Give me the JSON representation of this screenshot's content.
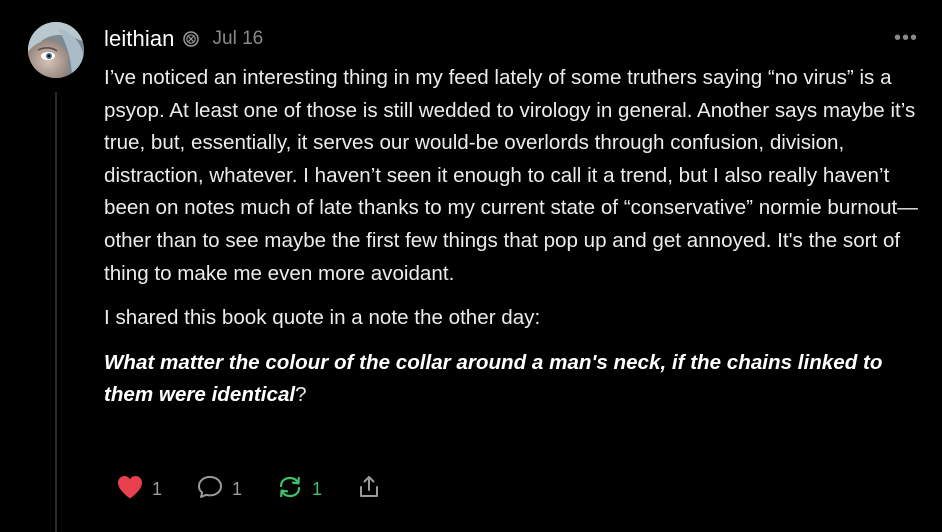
{
  "note": {
    "author": "leithian",
    "date": "Jul 16",
    "more_label": "•••",
    "paragraphs": [
      "I’ve noticed an interesting thing in my feed lately of some truthers saying “no virus” is a psyop. At least one of those is still wedded to virology in general. Another says maybe it’s true, but, essentially, it serves our would-be overlords through confusion, division, distraction, whatever. I haven’t seen it enough to call it a trend, but I also really haven’t been on notes much of late thanks to my current state of “conservative” normie burnout—other than to see maybe the first few things that pop up and get annoyed. It's the sort of thing to make me even more avoidant.",
      "I shared this book quote in a note the other day:"
    ],
    "quote": "What matter the colour of the collar around a man's neck, if the chains linked to them were identical",
    "quote_end": "?"
  },
  "actions": {
    "like_count": "1",
    "comment_count": "1",
    "restack_count": "1"
  },
  "icons": {
    "like": "heart-icon",
    "comment": "comment-bubble-icon",
    "restack": "restack-arrows-icon",
    "share": "share-icon",
    "badge": "subscriber-badge-icon"
  },
  "colors": {
    "background": "#000000",
    "like": "#e8404e",
    "restack": "#3fbf6b",
    "muted": "#8a8a8a"
  }
}
